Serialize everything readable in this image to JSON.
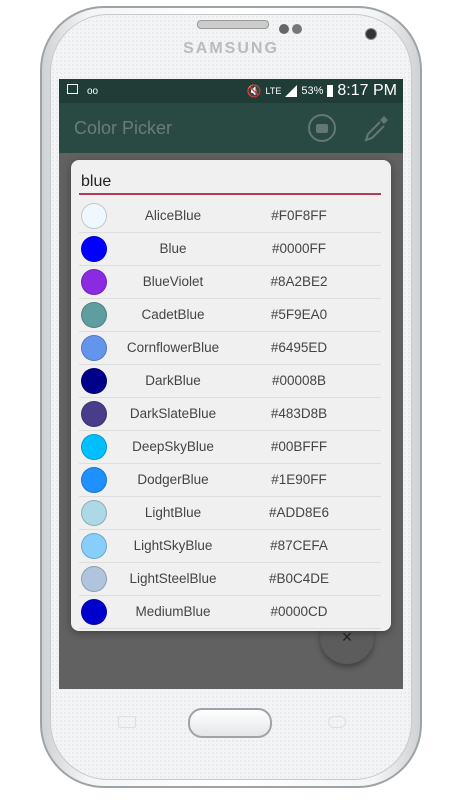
{
  "device": {
    "brand": "SAMSUNG"
  },
  "status_bar": {
    "network": "LTE",
    "battery": "53%",
    "time": "8:17 PM"
  },
  "toolbar": {
    "title": "Color Picker",
    "camera_icon": "camera-icon",
    "eyedropper_icon": "eyedropper-icon"
  },
  "search": {
    "value": "blue",
    "underline_color": "#B43A5A"
  },
  "colors": [
    {
      "name": "AliceBlue",
      "hex": "#F0F8FF"
    },
    {
      "name": "Blue",
      "hex": "#0000FF"
    },
    {
      "name": "BlueViolet",
      "hex": "#8A2BE2"
    },
    {
      "name": "CadetBlue",
      "hex": "#5F9EA0"
    },
    {
      "name": "CornflowerBlue",
      "hex": "#6495ED"
    },
    {
      "name": "DarkBlue",
      "hex": "#00008B"
    },
    {
      "name": "DarkSlateBlue",
      "hex": "#483D8B"
    },
    {
      "name": "DeepSkyBlue",
      "hex": "#00BFFF"
    },
    {
      "name": "DodgerBlue",
      "hex": "#1E90FF"
    },
    {
      "name": "LightBlue",
      "hex": "#ADD8E6"
    },
    {
      "name": "LightSkyBlue",
      "hex": "#87CEFA"
    },
    {
      "name": "LightSteelBlue",
      "hex": "#B0C4DE"
    },
    {
      "name": "MediumBlue",
      "hex": "#0000CD"
    }
  ],
  "fab": {
    "icon": "close-icon",
    "label": "×"
  },
  "theme": {
    "primary_dark": "#1F3D36",
    "primary": "#294A42",
    "scrim": "#616161"
  }
}
